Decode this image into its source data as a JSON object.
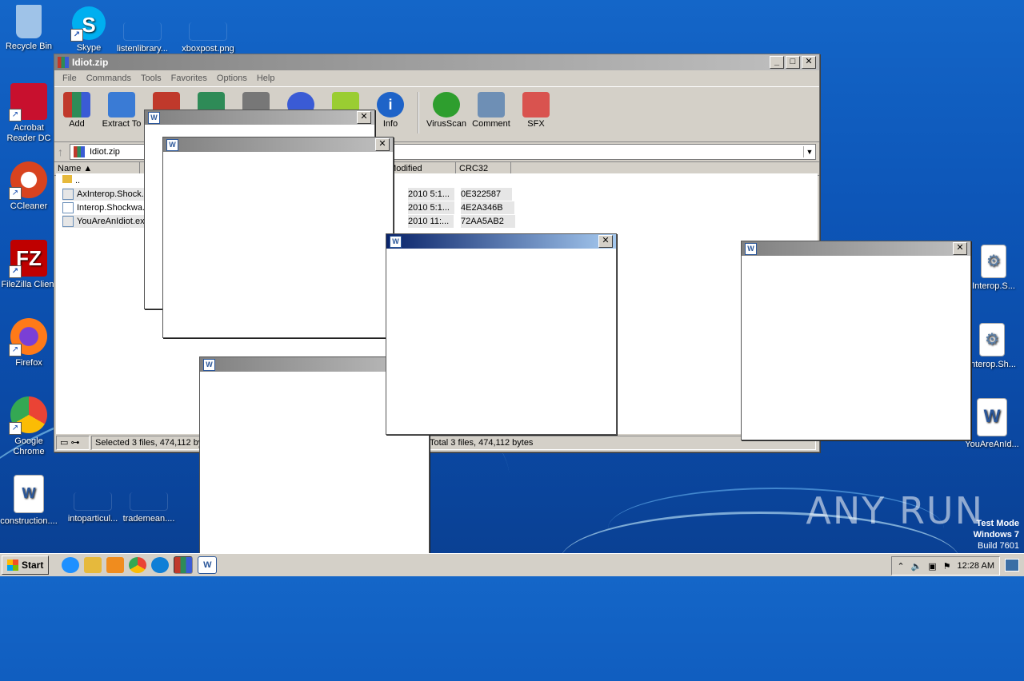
{
  "desktop": {
    "icons_left": [
      {
        "label": "Recycle Bin",
        "icon": "recycle-bin-icon",
        "color": "#9fc3e8"
      },
      {
        "label": "Acrobat Reader DC",
        "icon": "acrobat-icon",
        "color": "#c8102e"
      },
      {
        "label": "CCleaner",
        "icon": "ccleaner-icon",
        "color": "#d8431f"
      },
      {
        "label": "FileZilla Client",
        "icon": "filezilla-icon",
        "color": "#bf0000"
      },
      {
        "label": "Firefox",
        "icon": "firefox-icon",
        "color": "#ff7a18"
      },
      {
        "label": "Google Chrome",
        "icon": "chrome-icon",
        "color": "#34a853"
      },
      {
        "label": "construction....",
        "icon": "word-doc-icon",
        "color": "#2b579a"
      }
    ],
    "icons_top": [
      {
        "label": "Skype",
        "icon": "skype-icon",
        "color": "#00aff0"
      },
      {
        "label": "listenlibrary...",
        "icon": "file-icon"
      },
      {
        "label": "xboxpost.png",
        "icon": "image-icon"
      }
    ],
    "icons_bottom": [
      {
        "label": "intoparticul...",
        "icon": "file-icon"
      },
      {
        "label": "trademean....",
        "icon": "file-icon"
      }
    ],
    "icons_right": [
      {
        "label": "Interop.S...",
        "icon": "dll-icon"
      },
      {
        "label": "Interop.Sh...",
        "icon": "dll-icon"
      },
      {
        "label": "YouAreAnId...",
        "icon": "word-doc-icon"
      }
    ]
  },
  "winrar": {
    "title": "Idiot.zip",
    "menu": [
      "File",
      "Commands",
      "Tools",
      "Favorites",
      "Options",
      "Help"
    ],
    "toolbar": [
      {
        "label": "Add",
        "icon": "add-archive-icon",
        "color": "#c0392b"
      },
      {
        "label": "Extract To",
        "icon": "extract-folder-icon",
        "color": "#3a7bd5"
      },
      {
        "label": "",
        "icon": "test-icon",
        "color": "#c0392b"
      },
      {
        "label": "",
        "icon": "view-icon",
        "color": "#2e8b57"
      },
      {
        "label": "",
        "icon": "delete-icon",
        "color": "#777777"
      },
      {
        "label": "",
        "icon": "find-icon",
        "color": "#3a5bd5"
      },
      {
        "label": "",
        "icon": "wizard-icon",
        "color": "#9acd32"
      },
      {
        "label": "Info",
        "icon": "info-icon",
        "color": "#1e63c8"
      },
      {
        "label": "VirusScan",
        "icon": "virusscan-icon",
        "color": "#2e9e2e"
      },
      {
        "label": "Comment",
        "icon": "comment-icon",
        "color": "#6e8fb5"
      },
      {
        "label": "SFX",
        "icon": "sfx-icon",
        "color": "#d9534f"
      }
    ],
    "path": "Idiot.zip",
    "columns": [
      "Name",
      "Modified",
      "CRC32"
    ],
    "rows": [
      {
        "name": "..",
        "modified": "",
        "crc": ""
      },
      {
        "name": "AxInterop.Shock...",
        "modified": "2010 5:1...",
        "crc": "0E322587"
      },
      {
        "name": "Interop.Shockwa...",
        "modified": "2010 5:1...",
        "crc": "4E2A346B"
      },
      {
        "name": "YouAreAnIdiot.ex...",
        "modified": "2010 11:...",
        "crc": "72AA5AB2"
      }
    ],
    "status_left": "Selected 3 files, 474,112 by",
    "status_right": "Total 3 files, 474,112 bytes"
  },
  "taskbar": {
    "start": "Start",
    "clock": "12:28 AM"
  },
  "watermark": "ANY RUN",
  "testmode": [
    "Test Mode",
    "Windows 7",
    "Build 7601"
  ]
}
